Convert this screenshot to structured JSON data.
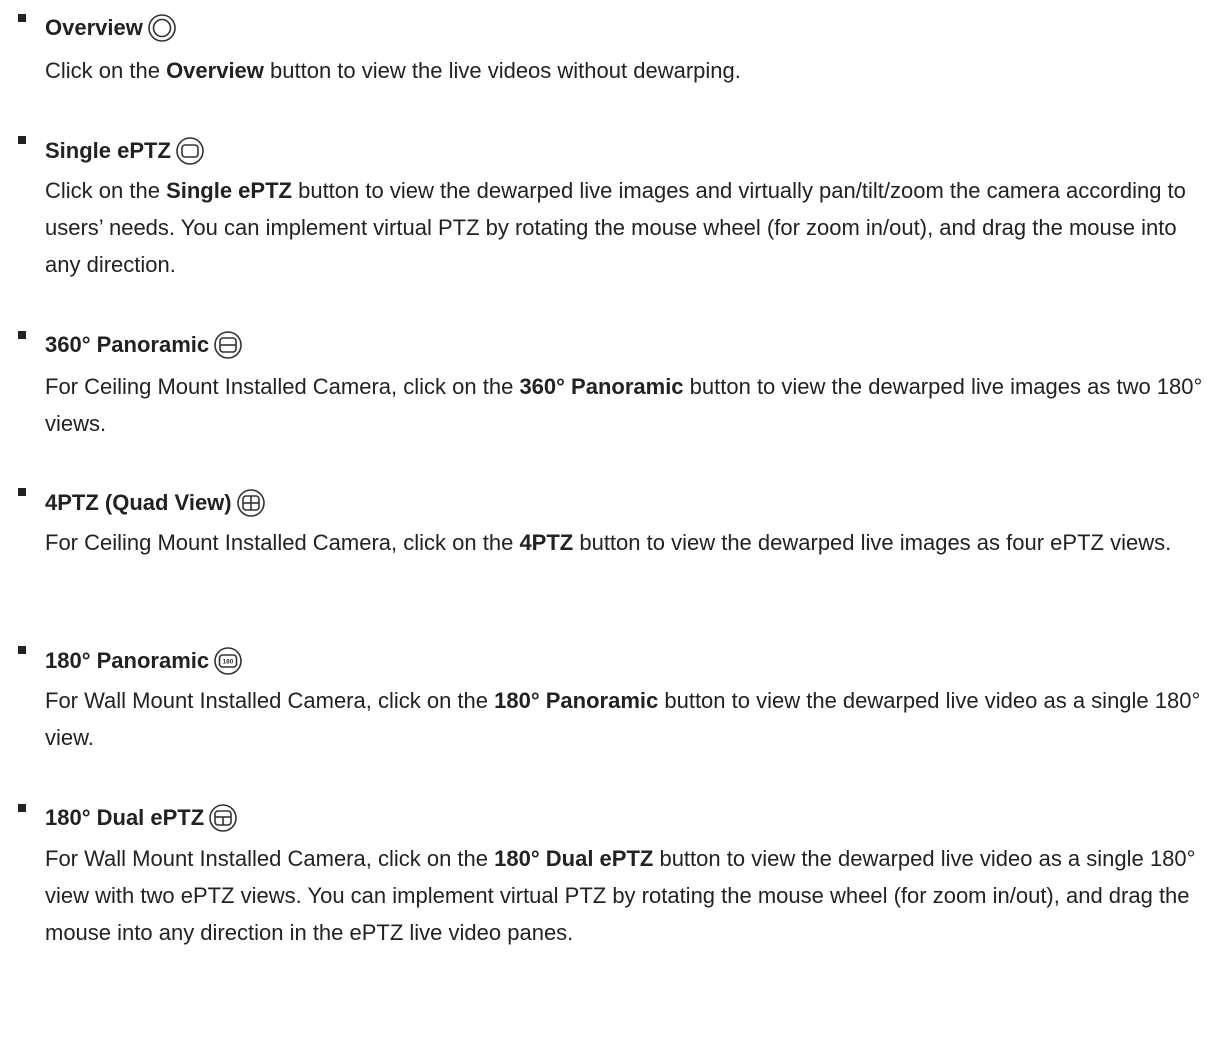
{
  "items": [
    {
      "title": "Overview",
      "icon": "overview-ring-icon",
      "desc_before": "Click on the ",
      "desc_bold": "Overview",
      "desc_after": " button to view the live videos without dewarping."
    },
    {
      "title": "Single ePTZ",
      "icon": "single-eptz-screen-icon",
      "desc_before": "Click on the ",
      "desc_bold": "Single ePTZ",
      "desc_after": " button to view the dewarped live images and virtually pan/tilt/zoom the camera according to users’ needs. You can implement virtual PTZ by rotating the mouse wheel (for zoom in/out), and drag the mouse into any direction."
    },
    {
      "title": "360° Panoramic",
      "icon": "panoramic-360-split-icon",
      "desc_before": "For Ceiling Mount Installed Camera, click on the ",
      "desc_bold": "360° Panoramic",
      "desc_after": " button to view the dewarped live images as two 180° views."
    },
    {
      "title": "4PTZ (Quad View)",
      "icon": "quad-view-grid-icon",
      "desc_before": "For Ceiling Mount Installed Camera, click on the ",
      "desc_bold": "4PTZ",
      "desc_after": " button to view the dewarped live images as four ePTZ views."
    },
    {
      "title": "180° Panoramic",
      "icon": "panoramic-180-icon",
      "icon_text": "180",
      "desc_before": "For Wall Mount Installed Camera, click on the ",
      "desc_bold": "180° Panoramic",
      "desc_after": " button to view the dewarped live video as a single 180° view."
    },
    {
      "title": "180° Dual ePTZ",
      "icon": "dual-eptz-180-icon",
      "desc_before": "For Wall Mount Installed Camera, click on the ",
      "desc_bold": "180° Dual ePTZ",
      "desc_after": " button to view the dewarped live video as a single 180° view with two ePTZ views. You can implement virtual PTZ by rotating the mouse wheel (for zoom in/out), and drag the mouse into any direction in the ePTZ live video panes."
    }
  ]
}
